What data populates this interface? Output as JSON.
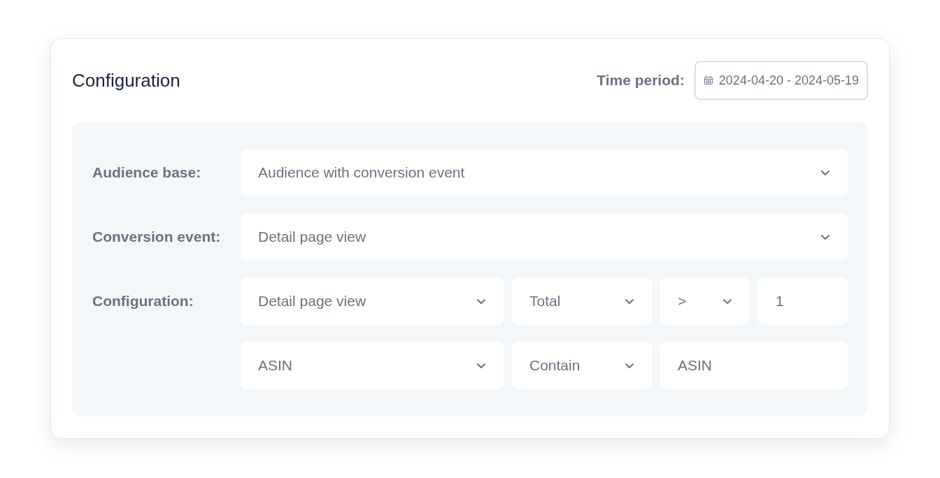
{
  "title": "Configuration",
  "time_period": {
    "label": "Time period:",
    "value": "2024-04-20 - 2024-05-19"
  },
  "rows": [
    {
      "label": "Audience base:",
      "fields": [
        {
          "kind": "select",
          "value": "Audience with conversion event"
        }
      ]
    },
    {
      "label": "Conversion event:",
      "fields": [
        {
          "kind": "select",
          "value": "Detail page view"
        }
      ]
    },
    {
      "label": "Configuration:",
      "fields": [
        {
          "kind": "select",
          "value": "Detail page view"
        },
        {
          "kind": "select",
          "value": "Total"
        },
        {
          "kind": "select",
          "value": ">"
        },
        {
          "kind": "input",
          "value": "1"
        }
      ]
    },
    {
      "fields": [
        {
          "kind": "select",
          "value": "ASIN"
        },
        {
          "kind": "select",
          "value": "Contain"
        },
        {
          "kind": "input",
          "value": "ASIN"
        }
      ]
    }
  ]
}
